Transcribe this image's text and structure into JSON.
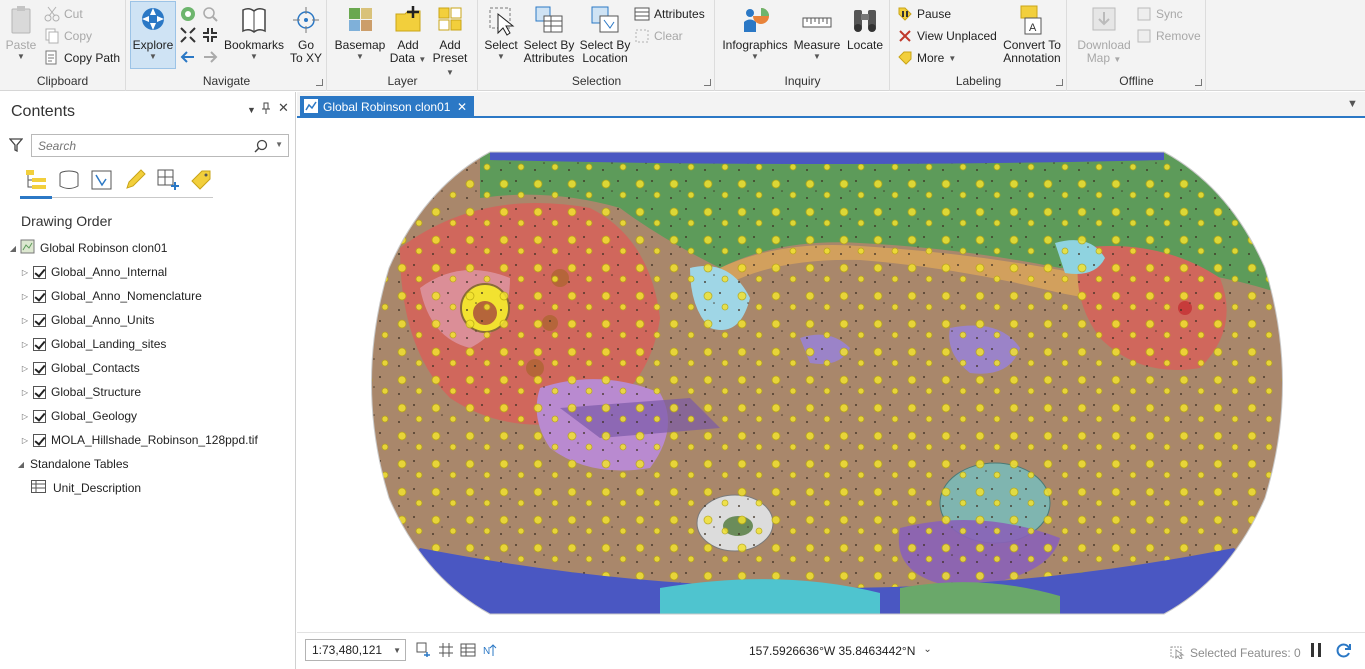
{
  "ribbon": {
    "clipboard": {
      "label": "Clipboard",
      "paste": "Paste",
      "cut": "Cut",
      "copy": "Copy",
      "copy_path": "Copy Path"
    },
    "navigate": {
      "label": "Navigate",
      "explore": "Explore",
      "bookmarks": "Bookmarks",
      "goto_xy_line1": "Go",
      "goto_xy_line2": "To XY"
    },
    "layer": {
      "label": "Layer",
      "basemap": "Basemap",
      "add_data_line1": "Add",
      "add_data_line2": "Data",
      "add_preset_line1": "Add",
      "add_preset_line2": "Preset"
    },
    "selection": {
      "label": "Selection",
      "select": "Select",
      "select_by_attr_line1": "Select By",
      "select_by_attr_line2": "Attributes",
      "select_by_loc_line1": "Select By",
      "select_by_loc_line2": "Location",
      "attributes": "Attributes",
      "clear": "Clear"
    },
    "inquiry": {
      "label": "Inquiry",
      "infographics": "Infographics",
      "measure": "Measure",
      "locate": "Locate"
    },
    "labeling": {
      "label": "Labeling",
      "pause": "Pause",
      "view_unplaced": "View Unplaced",
      "more": "More",
      "convert_line1": "Convert To",
      "convert_line2": "Annotation"
    },
    "offline": {
      "label": "Offline",
      "download_line1": "Download",
      "download_line2": "Map",
      "sync": "Sync",
      "remove": "Remove"
    }
  },
  "contents": {
    "title": "Contents",
    "search_placeholder": "Search",
    "drawing_order": "Drawing Order",
    "map_name": "Global Robinson clon01",
    "layers": [
      "Global_Anno_Internal",
      "Global_Anno_Nomenclature",
      "Global_Anno_Units",
      "Global_Landing_sites",
      "Global_Contacts",
      "Global_Structure",
      "Global_Geology",
      "MOLA_Hillshade_Robinson_128ppd.tif"
    ],
    "standalone_tables": "Standalone Tables",
    "tables": [
      "Unit_Description"
    ]
  },
  "map_view": {
    "tab_title": "Global Robinson clon01",
    "scale": "1:73,480,121",
    "coordinates": "157.5926636°W 35.8463442°N",
    "selected_features": "Selected Features: 0"
  },
  "colors": {
    "accent": "#2b78c5",
    "plains_brown": "#a9876b",
    "northern_green": "#5d9b5a",
    "volcanic_red": "#d0675c",
    "crater_yellow": "#f2e230",
    "basin_purple": "#8a62b8",
    "polar_blue": "#4a57c2"
  }
}
